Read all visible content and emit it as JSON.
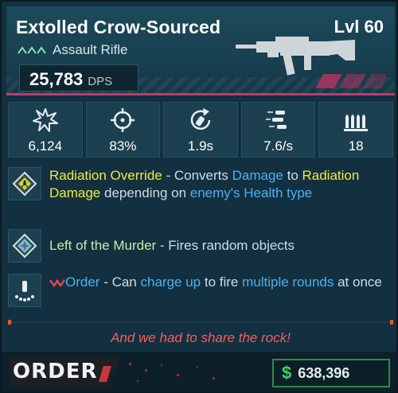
{
  "header": {
    "weapon_name": "Extolled Crow-Sourced",
    "level": "Lvl 60",
    "weapon_type": "Assault Rifle",
    "dps_value": "25,783",
    "dps_unit": "DPS"
  },
  "stats": [
    {
      "icon": "damage-burst-icon",
      "value": "6,124"
    },
    {
      "icon": "crosshair-icon",
      "value": "83%"
    },
    {
      "icon": "reload-icon",
      "value": "1.9s"
    },
    {
      "icon": "fire-rate-icon",
      "value": "7.6/s"
    },
    {
      "icon": "ammo-icon",
      "value": "18"
    }
  ],
  "perks": [
    {
      "icon": "radiation-diamond-icon",
      "name": "Radiation Override",
      "sep": " - Converts ",
      "kw1": "Damage",
      "mid1": " to ",
      "kw2": "Radiation Damage",
      "mid2": " depending on ",
      "kw3": "enemy's Health type"
    },
    {
      "icon": "star-diamond-icon",
      "name": "Left of the Murder",
      "desc": " - Fires random objects"
    },
    {
      "icon": "charge-rounds-icon",
      "name": "Order",
      "mid1": " - Can ",
      "kw1": "charge up",
      "mid2": " to fire ",
      "kw2": "multiple rounds",
      "tail": " at once"
    }
  ],
  "flavor_text": "And we had to share the rock!",
  "footer": {
    "brand": "ORDER",
    "currency_icon": "dollar-icon",
    "price": "638,396"
  },
  "colors": {
    "keyword_yellow": "#f5e93a",
    "keyword_blue": "#4fb0ee",
    "perk_green": "#bff0a6",
    "flavor_red": "#ff5a5a",
    "price_green": "#3ecf6a",
    "accent_pink": "#c13a6a"
  }
}
